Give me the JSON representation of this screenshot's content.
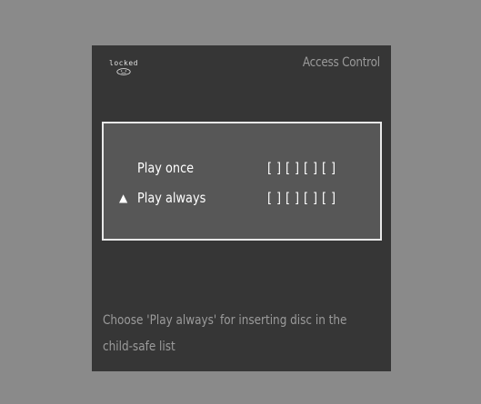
{
  "status": {
    "label": "locked",
    "icon": "sad-face-lock-icon"
  },
  "header": {
    "title": "Access Control"
  },
  "options": [
    {
      "label": "Play once",
      "code": "[ ] [ ] [ ] [ ]",
      "selected": false
    },
    {
      "label": "Play always",
      "code": "[ ] [ ] [ ] [ ]",
      "selected": true,
      "pointer": "▲"
    }
  ],
  "hint": {
    "line1": "Choose 'Play always' for inserting disc in the",
    "line2": "child-safe list"
  },
  "colors": {
    "page_background": "#8a8a8a",
    "screen_background": "#363636",
    "dialog_background": "#575757",
    "dialog_border": "#e8e8e8",
    "text_primary": "#ffffff",
    "text_muted": "#9a9a9a"
  }
}
